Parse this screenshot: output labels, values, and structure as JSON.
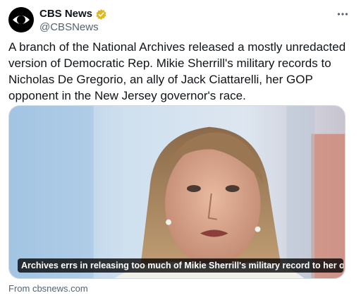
{
  "account": {
    "display_name": "CBS News",
    "handle": "@CBSNews",
    "verified_badge_color": "#e2b719"
  },
  "icons": {
    "avatar": "cbs-eye-logo-icon",
    "verified": "verified-badge-icon",
    "more": "more-options-icon"
  },
  "tweet": {
    "text": "A branch of the National Archives released a mostly unredacted version of Democratic Rep. Mikie Sherrill's military records to Nicholas De Gregorio, an ally of Jack Ciattarelli, her GOP opponent in the New Jersey governor's race."
  },
  "link_card": {
    "headline": "Archives errs in releasing too much of Mikie Sherrill's military record to her opponent in...",
    "source": "From cbsnews.com"
  },
  "colors": {
    "text_primary": "#0f1419",
    "text_secondary": "#536471",
    "border": "#cfd9de"
  }
}
